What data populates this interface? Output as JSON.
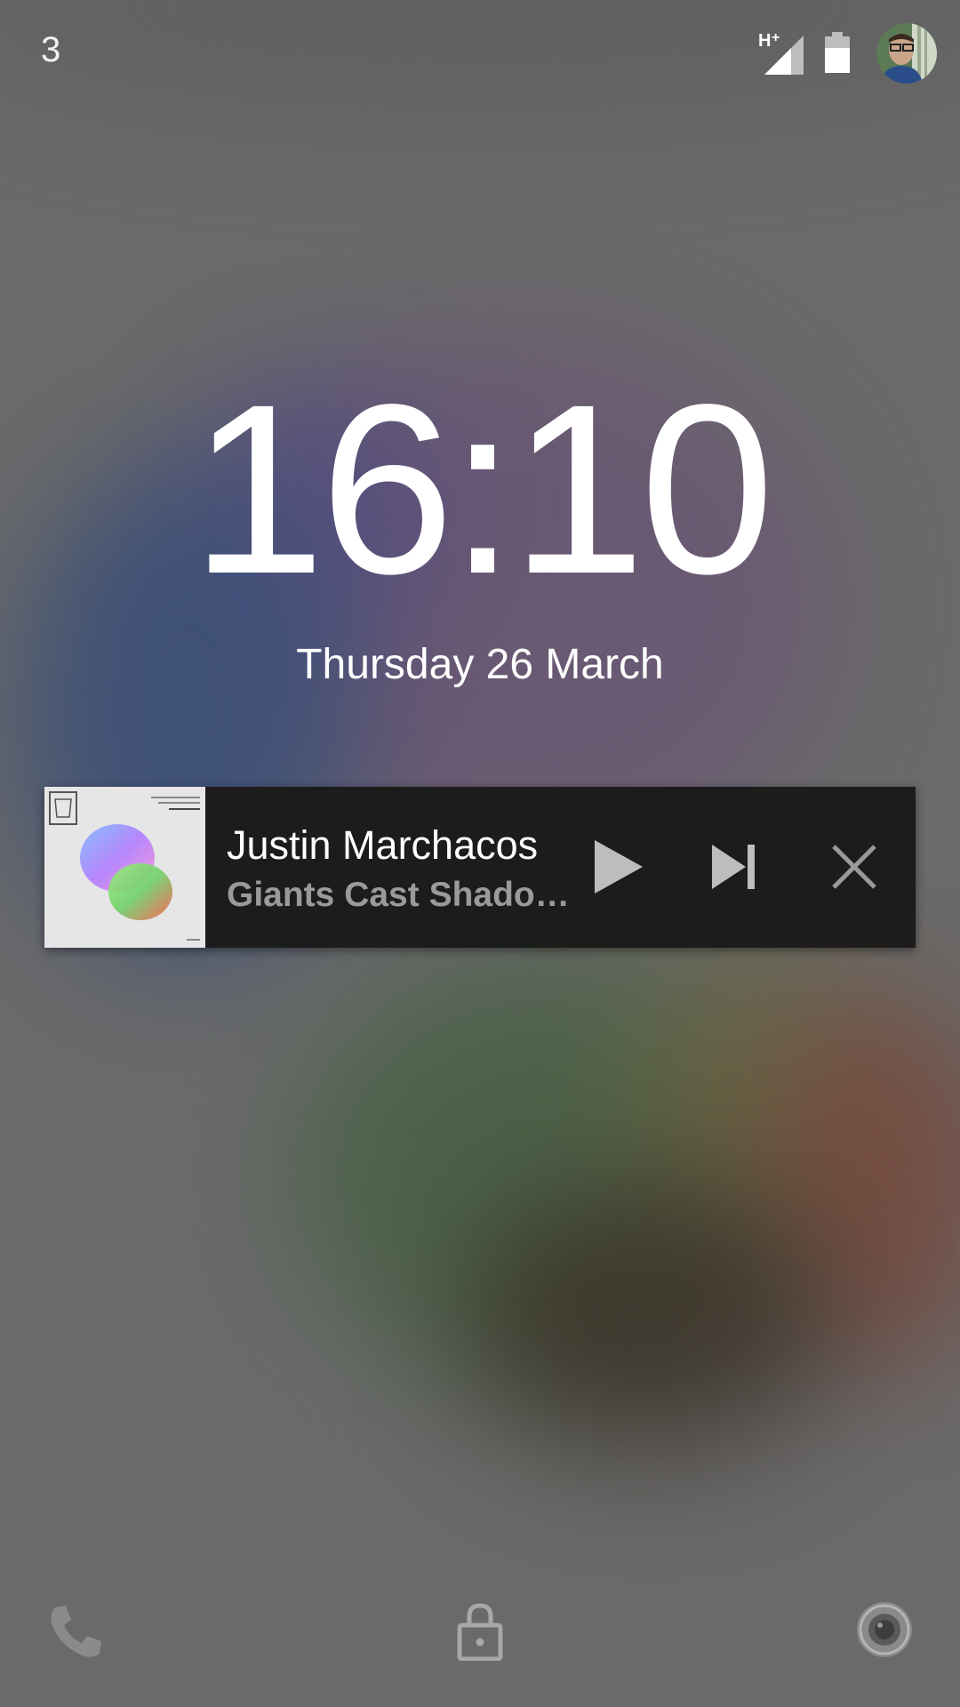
{
  "status_bar": {
    "notification_count": "3",
    "network_type_icon": "signal-h-plus-icon",
    "battery_icon": "battery-icon",
    "avatar_icon": "user-avatar"
  },
  "lockscreen": {
    "time": "16:10",
    "date": "Thursday 26 March"
  },
  "media_notification": {
    "artist": "Justin Marchacos",
    "title": "Giants Cast Shado…",
    "album_art_icon": "album-art",
    "controls": [
      "play-icon",
      "skip-next-icon",
      "close-icon"
    ]
  },
  "bottom_shortcuts": [
    "phone-icon",
    "lock-icon",
    "camera-icon"
  ],
  "colors": {
    "card_background": "#1c1c1c",
    "title_gray": "#9a9a9a",
    "icon_gray": "#bdbdbd"
  }
}
